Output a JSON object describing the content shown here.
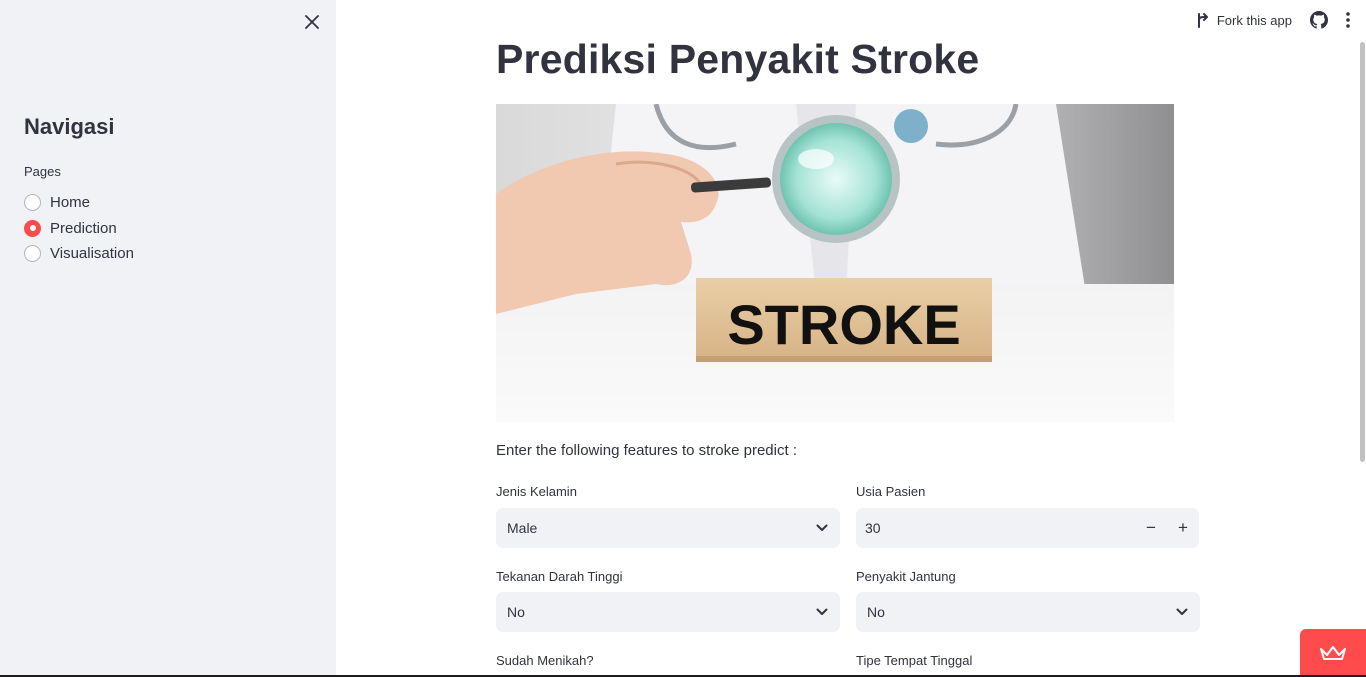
{
  "sidebar": {
    "title": "Navigasi",
    "pages_label": "Pages",
    "items": [
      {
        "label": "Home",
        "selected": false
      },
      {
        "label": "Prediction",
        "selected": true
      },
      {
        "label": "Visualisation",
        "selected": false
      }
    ]
  },
  "header": {
    "fork_label": "Fork this app"
  },
  "main": {
    "title": "Prediksi Penyakit Stroke",
    "hero_text": "STROKE",
    "intro": "Enter the following features to stroke predict :",
    "fields": {
      "gender": {
        "label": "Jenis Kelamin",
        "value": "Male"
      },
      "age": {
        "label": "Usia Pasien",
        "value": "30",
        "minus": "−",
        "plus": "+"
      },
      "hypertension": {
        "label": "Tekanan Darah Tinggi",
        "value": "No"
      },
      "heart_disease": {
        "label": "Penyakit Jantung",
        "value": "No"
      },
      "married": {
        "label": "Sudah Menikah?"
      },
      "residence": {
        "label": "Tipe Tempat Tinggal"
      }
    }
  },
  "colors": {
    "accent": "#ff4b4b",
    "sidebar_bg": "#f0f2f6",
    "text": "#31333f"
  }
}
